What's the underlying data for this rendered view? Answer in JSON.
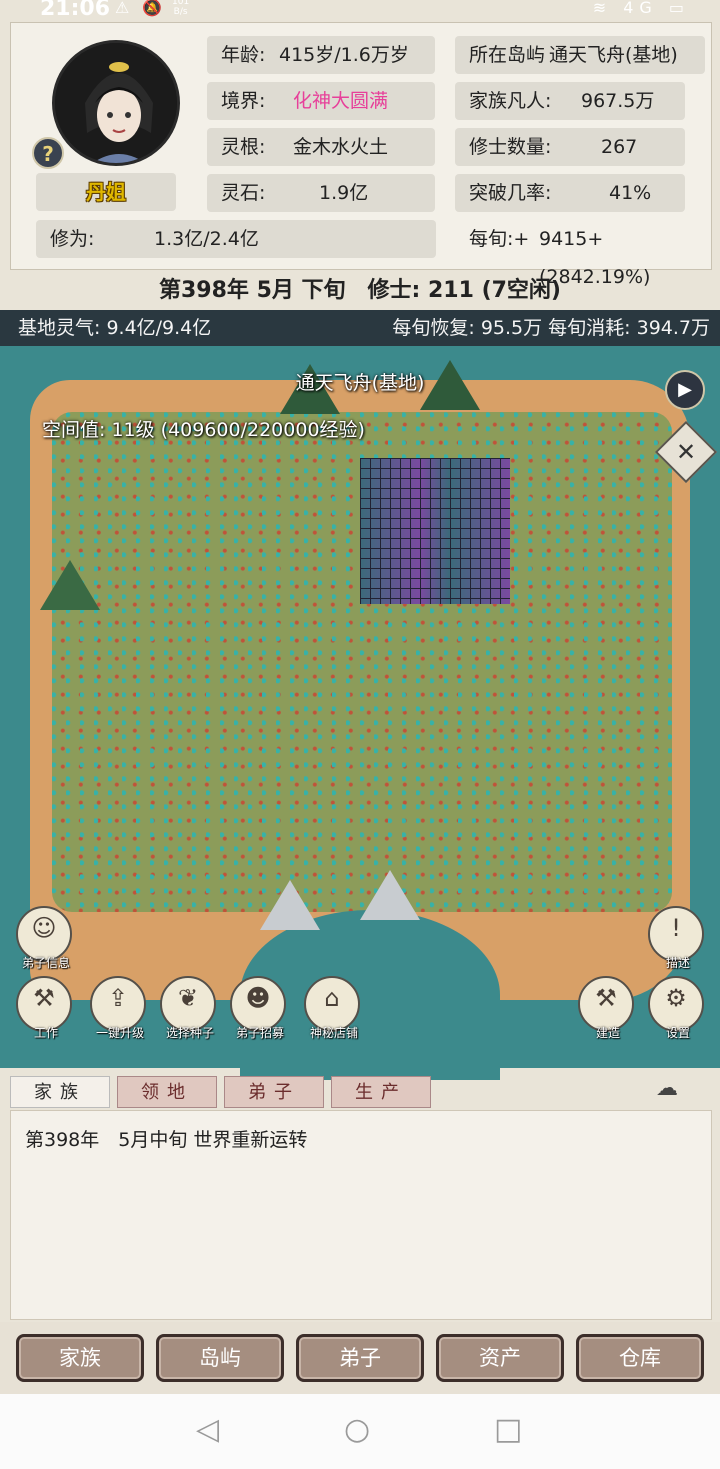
{
  "status_bar": {
    "time": "21:06",
    "net_speed_value": "101",
    "net_speed_unit": "B/s",
    "network_label": "4G"
  },
  "profile": {
    "name": "丹姐",
    "age_label": "年龄:",
    "age_value": "415岁/1.6万岁",
    "realm_label": "境界:",
    "realm_value": "化神大圆满",
    "root_label": "灵根:",
    "root_value": "金木水火土",
    "stone_label": "灵石:",
    "stone_value": "1.9亿",
    "island_label": "所在岛屿",
    "island_value": "通天飞舟(基地)",
    "mortals_label": "家族凡人:",
    "mortals_value": "967.5万",
    "cultivators_label": "修士数量:",
    "cultivators_value": "267",
    "breakthrough_label": "突破几率:",
    "breakthrough_value": "41%",
    "cultivation_label": "修为:",
    "cultivation_value": "1.3亿/2.4亿",
    "per_period_label": "每旬:+",
    "per_period_value": "9415+(2842.19%)"
  },
  "date_line": "第398年 5月 下旬　修士: 211 (7空闲)",
  "map_bar": {
    "qi": "基地灵气: 9.4亿/9.4亿",
    "recovery": "每旬恢复: 95.5万 每旬消耗: 394.7万"
  },
  "map": {
    "title": "通天飞舟(基地)",
    "space_value": "空间值: 11级 (409600/220000经验)"
  },
  "map_buttons": {
    "disciple_info": "弟子信息",
    "work": "工作",
    "one_key_upgrade": "一键升级",
    "select_seed": "选择种子",
    "recruit": "弟子招募",
    "mystery_shop": "神秘店铺",
    "describe": "描述",
    "build": "建造",
    "settings": "设置"
  },
  "tabs": [
    "家族",
    "领地",
    "弟子",
    "生产"
  ],
  "log": {
    "entry": "第398年　5月中旬 世界重新运转"
  },
  "bottom_nav": [
    "家族",
    "岛屿",
    "弟子",
    "资产",
    "仓库"
  ],
  "colors": {
    "realm_pink": "#e7409a",
    "name_gold": "#e0b800",
    "sea": "#3c8a8c",
    "map_bar": "#2a3840"
  }
}
